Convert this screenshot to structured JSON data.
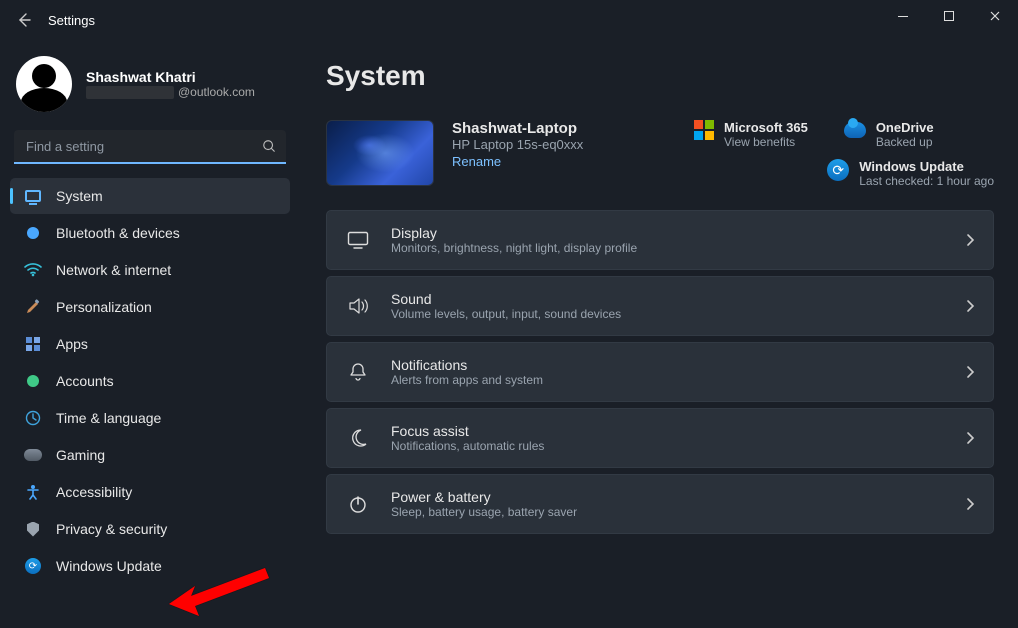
{
  "titlebar": {
    "title": "Settings"
  },
  "profile": {
    "name": "Shashwat Khatri",
    "email_suffix": "@outlook.com"
  },
  "search": {
    "placeholder": "Find a setting"
  },
  "sidebar": {
    "items": [
      {
        "id": "system",
        "label": "System",
        "active": true
      },
      {
        "id": "bluetooth",
        "label": "Bluetooth & devices"
      },
      {
        "id": "network",
        "label": "Network & internet"
      },
      {
        "id": "personalization",
        "label": "Personalization"
      },
      {
        "id": "apps",
        "label": "Apps"
      },
      {
        "id": "accounts",
        "label": "Accounts"
      },
      {
        "id": "time",
        "label": "Time & language"
      },
      {
        "id": "gaming",
        "label": "Gaming"
      },
      {
        "id": "accessibility",
        "label": "Accessibility"
      },
      {
        "id": "privacy",
        "label": "Privacy & security"
      },
      {
        "id": "update",
        "label": "Windows Update"
      }
    ]
  },
  "page": {
    "title": "System",
    "device": {
      "name": "Shashwat-Laptop",
      "model": "HP Laptop 15s-eq0xxx",
      "rename": "Rename"
    },
    "cloud": {
      "m365": {
        "title": "Microsoft 365",
        "sub": "View benefits"
      },
      "onedrive": {
        "title": "OneDrive",
        "sub": "Backed up"
      },
      "update": {
        "title": "Windows Update",
        "sub": "Last checked: 1 hour ago"
      }
    },
    "settings": [
      {
        "id": "display",
        "title": "Display",
        "sub": "Monitors, brightness, night light, display profile"
      },
      {
        "id": "sound",
        "title": "Sound",
        "sub": "Volume levels, output, input, sound devices"
      },
      {
        "id": "notifications",
        "title": "Notifications",
        "sub": "Alerts from apps and system"
      },
      {
        "id": "focus",
        "title": "Focus assist",
        "sub": "Notifications, automatic rules"
      },
      {
        "id": "power",
        "title": "Power & battery",
        "sub": "Sleep, battery usage, battery saver"
      }
    ]
  }
}
